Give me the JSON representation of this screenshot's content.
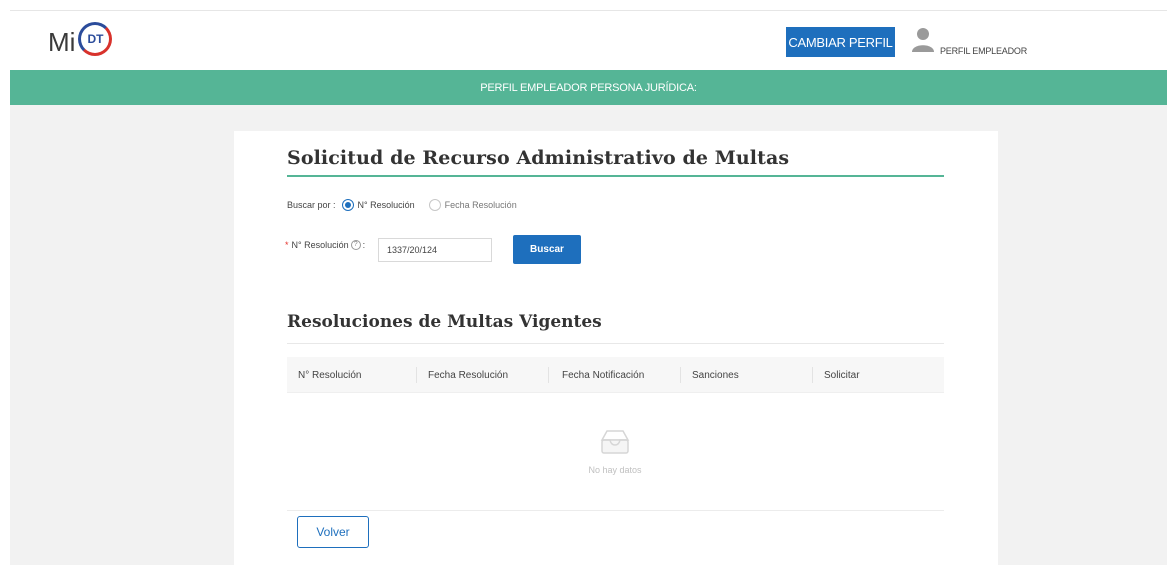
{
  "header": {
    "logo_text": "Mi",
    "logo_badge": "DT",
    "change_profile_label": "CAMBIAR PERFIL",
    "user_label": "PERFIL EMPLEADOR"
  },
  "banner": {
    "text": "PERFIL EMPLEADOR PERSONA JURÍDICA:"
  },
  "form": {
    "title": "Solicitud de Recurso Administrativo de Multas",
    "search_by_label": "Buscar por :",
    "options": [
      {
        "label": "N° Resolución",
        "checked": true
      },
      {
        "label": "Fecha Resolución",
        "checked": false
      }
    ],
    "required_marker": "*",
    "field_label": "N° Resolución",
    "help_glyph": "?",
    "field_colon": ":",
    "field_value": "1337/20/124",
    "search_button": "Buscar"
  },
  "results": {
    "title": "Resoluciones de Multas Vigentes",
    "columns": [
      "N° Resolución",
      "Fecha Resolución",
      "Fecha Notificación",
      "Sanciones",
      "Solicitar"
    ],
    "empty_text": "No hay datos"
  },
  "footer": {
    "back_button": "Volver"
  },
  "colors": {
    "primary": "#1e6fbd",
    "accent_green": "#55b596",
    "required": "#e5322c"
  }
}
